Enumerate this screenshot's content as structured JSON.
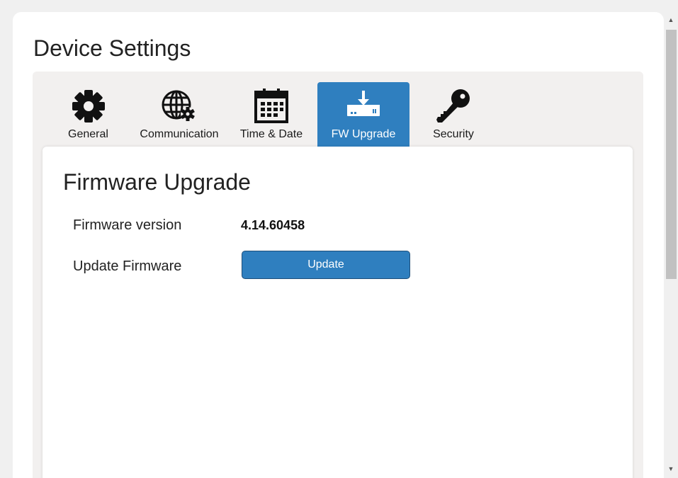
{
  "page": {
    "title": "Device Settings"
  },
  "tabs": [
    {
      "label": "General",
      "icon": "gear-icon",
      "active": false
    },
    {
      "label": "Communication",
      "icon": "globe-gear-icon",
      "active": false
    },
    {
      "label": "Time & Date",
      "icon": "calendar-icon",
      "active": false
    },
    {
      "label": "FW Upgrade",
      "icon": "firmware-download-icon",
      "active": true
    },
    {
      "label": "Security",
      "icon": "key-icon",
      "active": false
    }
  ],
  "firmware": {
    "section_title": "Firmware Upgrade",
    "version_label": "Firmware version",
    "version_value": "4.14.60458",
    "update_label": "Update Firmware",
    "update_button": "Update"
  },
  "colors": {
    "accent": "#2f7fbf",
    "panel_bg": "#f2f0ef",
    "text": "#222222"
  },
  "scrollbar": {
    "up_arrow": "▲",
    "down_arrow": "▼"
  }
}
